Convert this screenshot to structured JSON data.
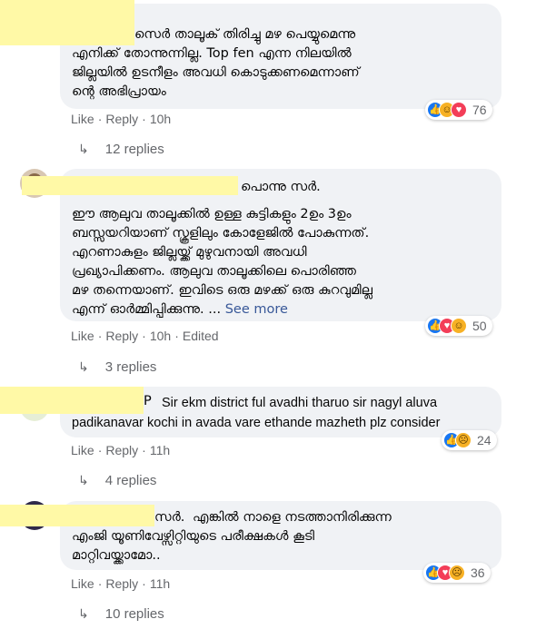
{
  "comments": [
    {
      "name": "",
      "lines": [
        "സെർ താലൂക് തിരിച്ചു മഴ പെയ്യുമെന്നു",
        "എനിക്ക് തോന്നുന്നില്ല. Top fen എന്ന നിലയിൽ",
        "ജില്ലയിൽ ഉടനീളം അവധി കൊടുക്കണമെന്നാണ്",
        "ന്റെ അഭിപ്രായം"
      ],
      "like": "Like",
      "reply": "Reply",
      "time": "10h",
      "edited": "",
      "reaction_count": "76",
      "reactions": [
        "like-icon",
        "haha-icon",
        "love-icon"
      ],
      "replies": "12 replies"
    },
    {
      "name": "പൊന്നു സർ.",
      "lines": [
        "ഈ ആലുവ താലൂക്കിൽ ഉള്ള കുട്ടികളും 2ഉം 3ഉം",
        "ബസ്സയറിയാണ് സ്കൂളിലും കോളേജിൽ പോകുന്നത്.",
        "എറണാകുളം ജില്ലയ്ക്ക് മുഴുവനായി അവധി",
        "പ്രഖ്യാപിക്കണം. ആലുവ താലൂക്കിലെ പൊരിഞ്ഞ",
        "മഴ തന്നെയാണ്. ഇവിടെ ഒരു മഴക്ക് ഒരു കുറവുമില്ല",
        "എന്ന് ഓർമ്മിപ്പിക്കുന്നു. ..."
      ],
      "see_more": "See more",
      "like": "Like",
      "reply": "Reply",
      "time": "10h",
      "edited": "Edited",
      "reaction_count": "50",
      "reactions": [
        "like-icon",
        "love-icon",
        "haha-icon"
      ],
      "replies": "3 replies"
    },
    {
      "name": "P",
      "lines": [
        "Sir ekm district ful avadhi tharuo sir nagyl aluva",
        "padikanavar kochi in avada vare ethande mazheth plz consider"
      ],
      "like": "Like",
      "reply": "Reply",
      "time": "11h",
      "edited": "",
      "reaction_count": "24",
      "reactions": [
        "like-icon",
        "sad-icon"
      ],
      "replies": "4 replies"
    },
    {
      "name": "സർ.",
      "lines": [
        "എങ്കിൽ നാളെ നടത്താനിരിക്കുന്ന",
        "എംജി യൂണിവേഴ്സിറ്റിയുടെ പരീക്ഷകൾ കൂടി",
        "മാറ്റിവയ്ക്കാമോ.."
      ],
      "like": "Like",
      "reply": "Reply",
      "time": "11h",
      "edited": "",
      "reaction_count": "36",
      "reactions": [
        "like-icon",
        "love-icon",
        "sad-icon"
      ],
      "replies": "10 replies"
    }
  ],
  "colors": {
    "bubble": "#f0f2f5",
    "name_mask": "#fff9a6",
    "meta": "#65676b",
    "link": "#385898",
    "like": "#1877f2",
    "love": "#f33e58",
    "haha_sad": "#f7b125"
  }
}
